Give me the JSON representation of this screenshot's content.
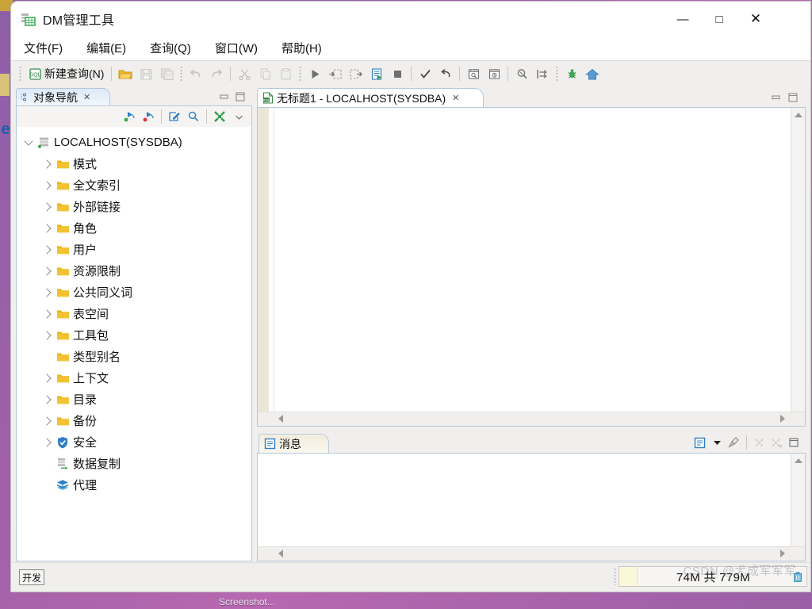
{
  "desktop": {
    "edge_icon_glyph": "e",
    "taskbar_label": "Screenshot..."
  },
  "window": {
    "title": "DM管理工具",
    "title_icon": "database-grid-icon",
    "controls": {
      "minimize": "—",
      "maximize": "□",
      "close": "✕"
    }
  },
  "menu": {
    "items": [
      {
        "label": "文件(F)",
        "name": "menu-file"
      },
      {
        "label": "编辑(E)",
        "name": "menu-edit"
      },
      {
        "label": "查询(Q)",
        "name": "menu-query"
      },
      {
        "label": "窗口(W)",
        "name": "menu-window"
      },
      {
        "label": "帮助(H)",
        "name": "menu-help"
      }
    ]
  },
  "toolbar": {
    "new_query_label": "新建查询(N)",
    "buttons": [
      {
        "name": "open-folder-button",
        "icon": "folder-open-icon",
        "enabled": true
      },
      {
        "name": "save-button",
        "icon": "save-icon",
        "enabled": false
      },
      {
        "name": "save-all-button",
        "icon": "save-all-icon",
        "enabled": false
      },
      {
        "name": "undo-button",
        "icon": "undo-icon",
        "enabled": false
      },
      {
        "name": "redo-button",
        "icon": "redo-icon",
        "enabled": false
      },
      {
        "name": "cut-button",
        "icon": "scissors-icon",
        "enabled": false
      },
      {
        "name": "copy-button",
        "icon": "copy-icon",
        "enabled": false
      },
      {
        "name": "paste-button",
        "icon": "paste-icon",
        "enabled": false
      },
      {
        "name": "execute-button",
        "icon": "play-triangle-icon",
        "enabled": true
      },
      {
        "name": "execute-step-button",
        "icon": "step-into-icon",
        "enabled": true
      },
      {
        "name": "execute-line-button",
        "icon": "step-over-icon",
        "enabled": true
      },
      {
        "name": "execute-script-button",
        "icon": "run-script-icon",
        "enabled": true
      },
      {
        "name": "stop-button",
        "icon": "stop-square-icon",
        "enabled": true
      },
      {
        "name": "commit-button",
        "icon": "check-mark-icon",
        "enabled": true
      },
      {
        "name": "rollback-button",
        "icon": "rollback-arrow-icon",
        "enabled": true
      },
      {
        "name": "plan-button",
        "icon": "explain-plan-icon",
        "enabled": true
      },
      {
        "name": "history-button",
        "icon": "clock-plan-icon",
        "enabled": true
      },
      {
        "name": "find-button",
        "icon": "magnify-script-icon",
        "enabled": true
      },
      {
        "name": "format-button",
        "icon": "format-arrow-icon",
        "enabled": true
      },
      {
        "name": "debug-button",
        "icon": "bug-icon",
        "enabled": true
      },
      {
        "name": "home-button",
        "icon": "home-icon",
        "enabled": true
      }
    ]
  },
  "navigator": {
    "tab_label": "对象导航",
    "tab_icon": "navigator-icon",
    "tab_close": "✕",
    "panel_minimize": "minimize-icon",
    "panel_maximize": "maximize-icon",
    "toolbar": [
      {
        "name": "connect-button",
        "icon": "connect-green-icon"
      },
      {
        "name": "disconnect-button",
        "icon": "disconnect-red-icon"
      },
      {
        "name": "edit-button",
        "icon": "edit-pencil-icon"
      },
      {
        "name": "search-button",
        "icon": "search-magnifier-icon"
      },
      {
        "name": "collapse-all-button",
        "icon": "collapse-all-icon"
      },
      {
        "name": "view-menu-button",
        "icon": "chevron-down-icon"
      }
    ],
    "tree": [
      {
        "label": "LOCALHOST(SYSDBA)",
        "level": 1,
        "expandable": true,
        "expanded": true,
        "icon": "server-icon"
      },
      {
        "label": "模式",
        "level": 2,
        "expandable": true,
        "expanded": false,
        "icon": "folder-icon"
      },
      {
        "label": "全文索引",
        "level": 2,
        "expandable": true,
        "expanded": false,
        "icon": "folder-icon"
      },
      {
        "label": "外部链接",
        "level": 2,
        "expandable": true,
        "expanded": false,
        "icon": "folder-icon"
      },
      {
        "label": "角色",
        "level": 2,
        "expandable": true,
        "expanded": false,
        "icon": "folder-icon"
      },
      {
        "label": "用户",
        "level": 2,
        "expandable": true,
        "expanded": false,
        "icon": "folder-icon"
      },
      {
        "label": "资源限制",
        "level": 2,
        "expandable": true,
        "expanded": false,
        "icon": "folder-icon"
      },
      {
        "label": "公共同义词",
        "level": 2,
        "expandable": true,
        "expanded": false,
        "icon": "folder-icon"
      },
      {
        "label": "表空间",
        "level": 2,
        "expandable": true,
        "expanded": false,
        "icon": "folder-icon"
      },
      {
        "label": "工具包",
        "level": 2,
        "expandable": true,
        "expanded": false,
        "icon": "folder-icon"
      },
      {
        "label": "类型别名",
        "level": 2,
        "expandable": false,
        "expanded": false,
        "icon": "folder-icon"
      },
      {
        "label": "上下文",
        "level": 2,
        "expandable": true,
        "expanded": false,
        "icon": "folder-icon"
      },
      {
        "label": "目录",
        "level": 2,
        "expandable": true,
        "expanded": false,
        "icon": "folder-icon"
      },
      {
        "label": "备份",
        "level": 2,
        "expandable": true,
        "expanded": false,
        "icon": "folder-icon"
      },
      {
        "label": "安全",
        "level": 2,
        "expandable": true,
        "expanded": false,
        "icon": "shield-check-icon"
      },
      {
        "label": "数据复制",
        "level": 2,
        "expandable": false,
        "expanded": false,
        "icon": "replication-icon"
      },
      {
        "label": "代理",
        "level": 2,
        "expandable": false,
        "expanded": false,
        "icon": "layers-icon"
      }
    ]
  },
  "editor": {
    "tab_label": "无标题1 - LOCALHOST(SYSDBA)",
    "tab_icon": "sql-file-icon",
    "tab_close": "✕",
    "content": "",
    "panel_minimize": "minimize-icon",
    "panel_maximize": "maximize-icon"
  },
  "messages": {
    "tab_label": "消息",
    "tab_icon": "message-doc-icon",
    "content": "",
    "tools": [
      {
        "name": "message-view-button",
        "icon": "message-doc-icon",
        "enabled": true
      },
      {
        "name": "message-view-menu-button",
        "icon": "triangle-down-icon",
        "enabled": true
      },
      {
        "name": "clear-messages-button",
        "icon": "broom-icon",
        "enabled": true
      },
      {
        "name": "close-message-button",
        "icon": "x-scatter-icon",
        "enabled": false
      },
      {
        "name": "close-all-messages-button",
        "icon": "x-scatter-all-icon",
        "enabled": false
      },
      {
        "name": "maximize-messages-button",
        "icon": "maximize-icon",
        "enabled": true
      }
    ]
  },
  "status": {
    "mode_label": "开发",
    "memory_text": "74M 共 779M",
    "memory_used_mb": 74,
    "memory_total_mb": 779,
    "trash_icon": "trash-icon"
  },
  "watermark": "CSDN @尤成军军军"
}
